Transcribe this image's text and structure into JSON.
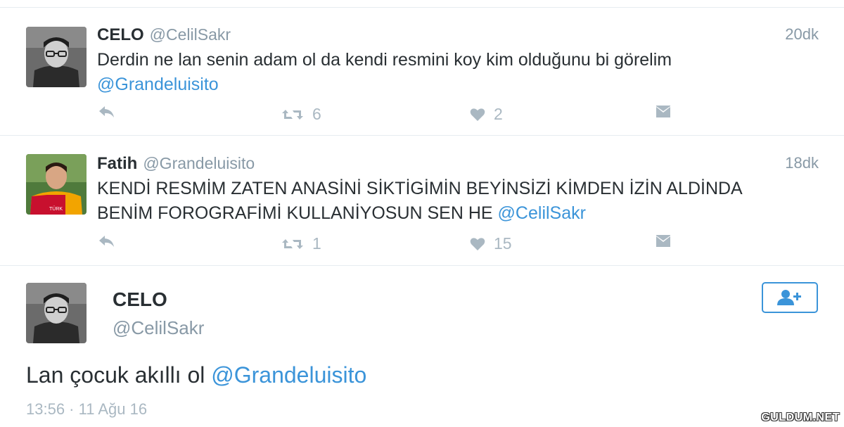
{
  "tweets": [
    {
      "name": "CELO",
      "handle": "@CelilSakr",
      "time": "20dk",
      "text": "Derdin ne lan senin adam ol da kendi resmini koy kim olduğunu bi görelim",
      "mention": "@Grandeluisito",
      "retweets": "6",
      "likes": "2",
      "avatar_icon": "avatar-glasses-boy"
    },
    {
      "name": "Fatih",
      "handle": "@Grandeluisito",
      "time": "18dk",
      "text_line1": "KENDİ RESMİM ZATEN ANASİNİ SİKTİGİMİN BEYİNSİZİ KİMDEN İZİN ALDİNDA",
      "text_line2": "BENİM FOROGRAFİMİ KULLANİYOSUN SEN HE",
      "mention": "@CelilSakr",
      "retweets": "1",
      "likes": "15",
      "avatar_icon": "avatar-jersey-boy"
    }
  ],
  "detail": {
    "name": "CELO",
    "handle": "@CelilSakr",
    "text": "Lan çocuk akıllı ol",
    "mention": "@Grandeluisito",
    "timestamp": "13:56 · 11 Ağu 16",
    "follow_icon": "follow-user-icon"
  },
  "watermark": "GULDUM.NET",
  "colors": {
    "mention": "#3b94d9",
    "muted": "#8899a6",
    "icon": "#aab8c2",
    "text": "#292f33",
    "divider": "#e6ecf0"
  }
}
